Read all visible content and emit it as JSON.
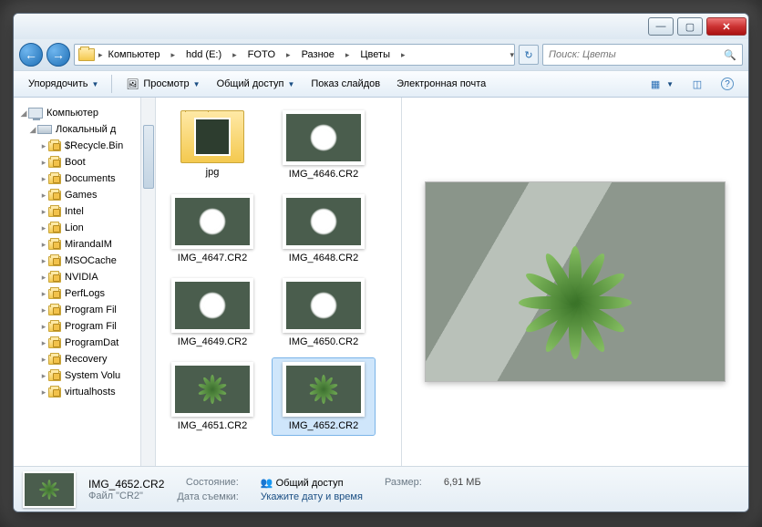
{
  "breadcrumb": [
    "Компьютер",
    "hdd (E:)",
    "FOTO",
    "Разное",
    "Цветы"
  ],
  "search": {
    "placeholder": "Поиск: Цветы"
  },
  "toolbar": {
    "organize": "Упорядочить",
    "preview": "Просмотр",
    "share": "Общий доступ",
    "slideshow": "Показ слайдов",
    "email": "Электронная почта"
  },
  "tree": {
    "root": "Компьютер",
    "drive": "Локальный д",
    "items": [
      "$Recycle.Bin",
      "Boot",
      "Documents",
      "Games",
      "Intel",
      "Lion",
      "MirandaIM",
      "MSOCache",
      "NVIDIA",
      "PerfLogs",
      "Program Fil",
      "Program Fil",
      "ProgramDat",
      "Recovery",
      "System Volu",
      "virtualhosts"
    ]
  },
  "files": [
    {
      "name": "jpg",
      "type": "folder"
    },
    {
      "name": "IMG_4646.CR2",
      "type": "white"
    },
    {
      "name": "IMG_4647.CR2",
      "type": "white"
    },
    {
      "name": "IMG_4648.CR2",
      "type": "white"
    },
    {
      "name": "IMG_4649.CR2",
      "type": "white"
    },
    {
      "name": "IMG_4650.CR2",
      "type": "white"
    },
    {
      "name": "IMG_4651.CR2",
      "type": "green"
    },
    {
      "name": "IMG_4652.CR2",
      "type": "green",
      "selected": true
    }
  ],
  "status": {
    "name": "IMG_4652.CR2",
    "type_label": "Файл \"CR2\"",
    "state_label": "Состояние:",
    "state_value": "Общий доступ",
    "date_label": "Дата съемки:",
    "date_value": "Укажите дату и время",
    "size_label": "Размер:",
    "size_value": "6,91 МБ"
  }
}
